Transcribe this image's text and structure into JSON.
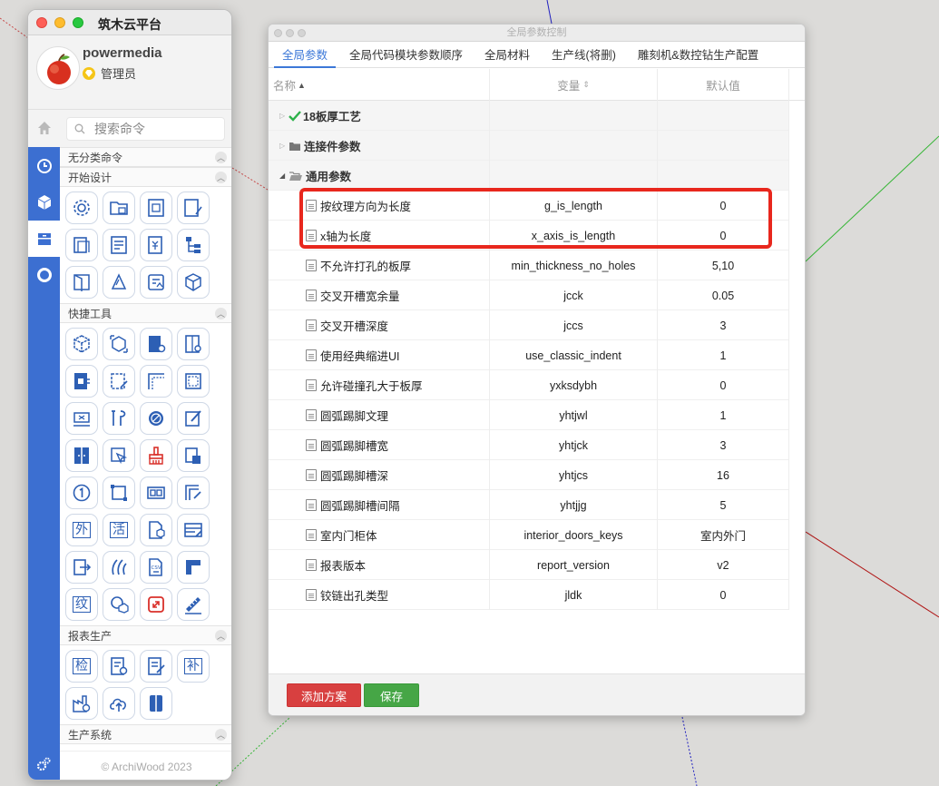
{
  "sidebar": {
    "app_title": "筑木云平台",
    "user_name": "powermedia",
    "user_role": "管理员",
    "search_placeholder": "搜索命令",
    "sections": [
      {
        "label": "无分类命令"
      },
      {
        "label": "开始设计"
      },
      {
        "label": "快捷工具"
      },
      {
        "label": "报表生产"
      },
      {
        "label": "生产系统"
      }
    ],
    "chars": {
      "wai": "外",
      "huo": "活",
      "wen": "纹",
      "jian": "检",
      "bu": "补",
      "csv": "CSV"
    },
    "footer": "© ArchiWood 2023",
    "accent_color": "#3c6fd1"
  },
  "dialog": {
    "window_title": "全局参数控制",
    "tabs": [
      "全局参数",
      "全局代码模块参数顺序",
      "全局材料",
      "生产线(将删)",
      "雕刻机&数控钻生产配置"
    ],
    "active_tab": 0,
    "columns": {
      "name": "名称",
      "variable": "变量",
      "default": "默认值"
    },
    "groups": [
      {
        "name": "18板厚工艺",
        "state": "collapsed",
        "icon": "check-icon"
      },
      {
        "name": "连接件参数",
        "state": "collapsed",
        "icon": "folder-icon"
      },
      {
        "name": "通用参数",
        "state": "expanded",
        "icon": "folder-open-icon"
      }
    ],
    "rows": [
      {
        "name": "按纹理方向为长度",
        "var": "g_is_length",
        "default": "0"
      },
      {
        "name": "x轴为长度",
        "var": "x_axis_is_length",
        "default": "0"
      },
      {
        "name": "不允许打孔的板厚",
        "var": "min_thickness_no_holes",
        "default": "5,10"
      },
      {
        "name": "交叉开槽宽余量",
        "var": "jcck",
        "default": "0.05"
      },
      {
        "name": "交叉开槽深度",
        "var": "jccs",
        "default": "3"
      },
      {
        "name": "使用经典缩进UI",
        "var": "use_classic_indent",
        "default": "1"
      },
      {
        "name": "允许碰撞孔大于板厚",
        "var": "yxksdybh",
        "default": "0"
      },
      {
        "name": "圆弧踢脚文理",
        "var": "yhtjwl",
        "default": "1"
      },
      {
        "name": "圆弧踢脚槽宽",
        "var": "yhtjck",
        "default": "3"
      },
      {
        "name": "圆弧踢脚槽深",
        "var": "yhtjcs",
        "default": "16"
      },
      {
        "name": "圆弧踢脚槽间隔",
        "var": "yhtjjg",
        "default": "5"
      },
      {
        "name": "室内门柜体",
        "var": "interior_doors_keys",
        "default": "室内外门"
      },
      {
        "name": "报表版本",
        "var": "report_version",
        "default": "v2"
      },
      {
        "name": "铰链出孔类型",
        "var": "jldk",
        "default": "0"
      }
    ],
    "buttons": {
      "add": "添加方案",
      "save": "保存"
    },
    "highlight_color": "#e8271d"
  }
}
